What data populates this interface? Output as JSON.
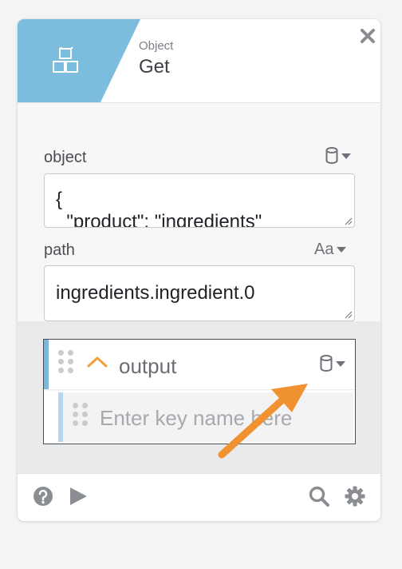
{
  "header": {
    "category": "Object",
    "title": "Get",
    "icon": "cubes-icon",
    "band_color": "#7cbcdd",
    "close_icon": "close-icon"
  },
  "fields": [
    {
      "label": "object",
      "type_icon": "database-icon",
      "value": "{\n  \"product\": \"ingredients\""
    },
    {
      "label": "path",
      "type_label": "Aa",
      "value": "ingredients.ingredient.0"
    }
  ],
  "output": {
    "label": "output",
    "type_icon": "database-icon",
    "key_placeholder": "Enter key name here"
  },
  "footer": {
    "left_icons": [
      "help-icon",
      "play-icon"
    ],
    "right_icons": [
      "search-icon",
      "gear-icon"
    ]
  },
  "annotation": {
    "color": "#f0922f",
    "icon": "arrow-icon"
  }
}
